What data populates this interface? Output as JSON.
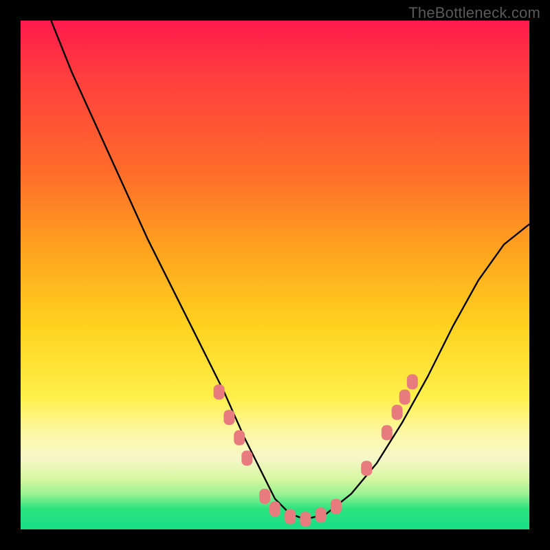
{
  "watermark": "TheBottleneck.com",
  "chart_data": {
    "type": "line",
    "title": "",
    "xlabel": "",
    "ylabel": "",
    "xlim": [
      0,
      100
    ],
    "ylim": [
      0,
      100
    ],
    "background_gradient": {
      "direction": "vertical",
      "stops": [
        {
          "pos": 0,
          "color": "#ff1a4d"
        },
        {
          "pos": 10,
          "color": "#ff3b3f"
        },
        {
          "pos": 30,
          "color": "#ff6d2a"
        },
        {
          "pos": 45,
          "color": "#ffa31f"
        },
        {
          "pos": 60,
          "color": "#ffd21f"
        },
        {
          "pos": 74,
          "color": "#fff04a"
        },
        {
          "pos": 81,
          "color": "#fdf8a5"
        },
        {
          "pos": 86,
          "color": "#f6f7c8"
        },
        {
          "pos": 90,
          "color": "#d8f7a2"
        },
        {
          "pos": 93,
          "color": "#9cf293"
        },
        {
          "pos": 96,
          "color": "#2be37e"
        },
        {
          "pos": 100,
          "color": "#19df87"
        }
      ]
    },
    "series": [
      {
        "name": "bottleneck-curve",
        "color": "#000000",
        "x": [
          6,
          10,
          15,
          20,
          25,
          30,
          35,
          40,
          44,
          48,
          50,
          53,
          56,
          60,
          65,
          70,
          75,
          80,
          85,
          90,
          95,
          100
        ],
        "y": [
          100,
          90,
          79,
          68,
          57,
          47,
          37,
          27,
          18,
          10,
          6,
          3,
          2,
          3,
          7,
          13,
          21,
          30,
          40,
          49,
          56,
          60
        ]
      }
    ],
    "markers": {
      "name": "highlight-dots",
      "color": "#e77b7e",
      "shape": "rounded-rect",
      "points": [
        {
          "x": 39,
          "y": 27
        },
        {
          "x": 41,
          "y": 22
        },
        {
          "x": 43,
          "y": 18
        },
        {
          "x": 44.5,
          "y": 14
        },
        {
          "x": 48,
          "y": 6.5
        },
        {
          "x": 50,
          "y": 4
        },
        {
          "x": 53,
          "y": 2.5
        },
        {
          "x": 56,
          "y": 2
        },
        {
          "x": 59,
          "y": 2.8
        },
        {
          "x": 62,
          "y": 4.5
        },
        {
          "x": 68,
          "y": 12
        },
        {
          "x": 72,
          "y": 19
        },
        {
          "x": 74,
          "y": 23
        },
        {
          "x": 75.5,
          "y": 26
        },
        {
          "x": 77,
          "y": 29
        }
      ]
    }
  }
}
